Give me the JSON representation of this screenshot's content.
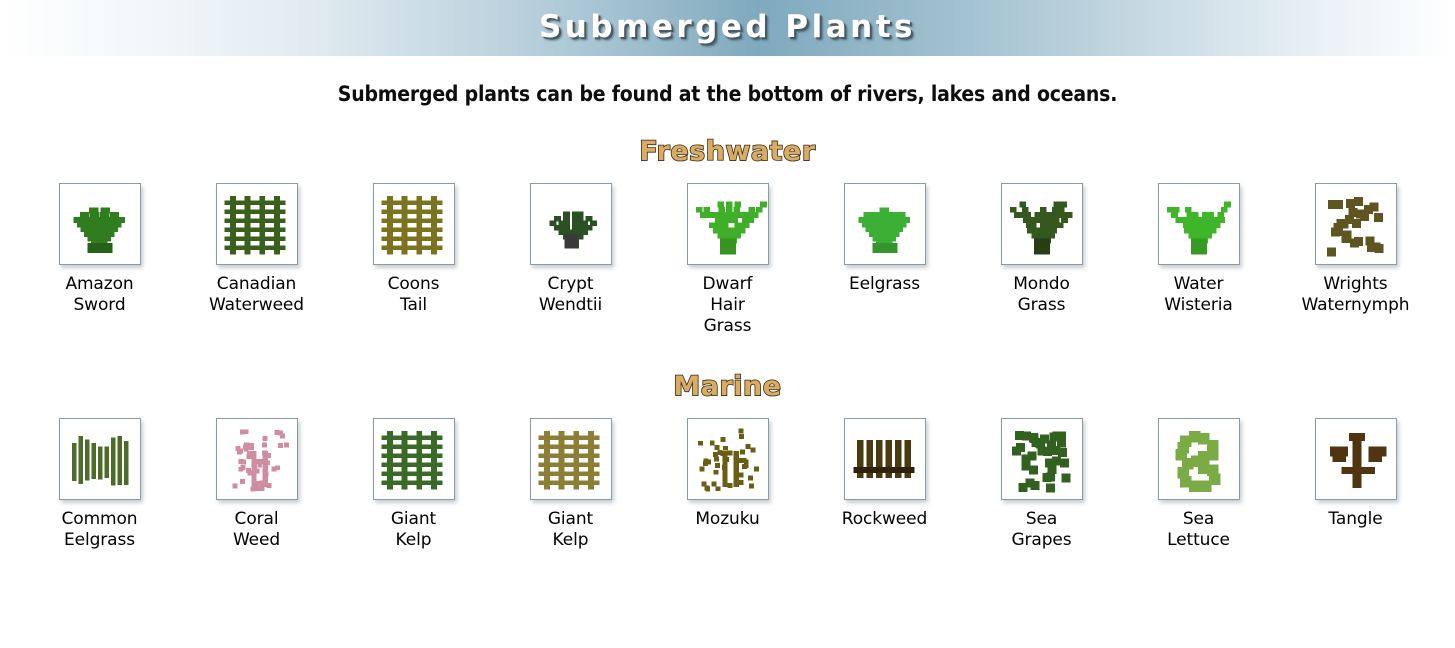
{
  "header": {
    "title": "Submerged Plants",
    "gradient_center_color": "#7fa9bd",
    "title_color": "#ffffff"
  },
  "subtitle": "Submerged plants can be found at the bottom of rivers, lakes and oceans.",
  "section_heading_color": "#d9ab63",
  "section_heading_outline_color": "#3a2a12",
  "sections": [
    {
      "heading": "Freshwater",
      "items": [
        {
          "label": "Amazon\nSword",
          "icon": "amazon-sword-icon",
          "color": "#2f7d1e"
        },
        {
          "label": "Canadian\nWaterweed",
          "icon": "canadian-waterweed-icon",
          "color": "#39601c"
        },
        {
          "label": "Coons\nTail",
          "icon": "coons-tail-icon",
          "color": "#7b7320"
        },
        {
          "label": "Crypt\nWendtii",
          "icon": "crypt-wendtii-icon",
          "color": "#2c5026"
        },
        {
          "label": "Dwarf\nHair\nGrass",
          "icon": "dwarf-hair-grass-icon",
          "color": "#3fae28"
        },
        {
          "label": "Eelgrass",
          "icon": "eelgrass-icon",
          "color": "#3cb034"
        },
        {
          "label": "Mondo\nGrass",
          "icon": "mondo-grass-icon",
          "color": "#35581f"
        },
        {
          "label": "Water\nWisteria",
          "icon": "water-wisteria-icon",
          "color": "#3fb52a"
        },
        {
          "label": "Wrights\nWaternymph",
          "icon": "wrights-waternymph-icon",
          "color": "#5e5521"
        }
      ]
    },
    {
      "heading": "Marine",
      "items": [
        {
          "label": "Common\nEelgrass",
          "icon": "common-eelgrass-icon",
          "color": "#4d6b29"
        },
        {
          "label": "Coral\nWeed",
          "icon": "coral-weed-icon",
          "color": "#d08da0"
        },
        {
          "label": "Giant\nKelp",
          "icon": "giant-kelp-green-icon",
          "color": "#3a6b26"
        },
        {
          "label": "Giant\nKelp",
          "icon": "giant-kelp-olive-icon",
          "color": "#8a7f34"
        },
        {
          "label": "Mozuku",
          "icon": "mozuku-icon",
          "color": "#6b5c16"
        },
        {
          "label": "Rockweed",
          "icon": "rockweed-icon",
          "color": "#4a3a10"
        },
        {
          "label": "Sea\nGrapes",
          "icon": "sea-grapes-icon",
          "color": "#32611f"
        },
        {
          "label": "Sea\nLettuce",
          "icon": "sea-lettuce-icon",
          "color": "#7aab45"
        },
        {
          "label": "Tangle",
          "icon": "tangle-icon",
          "color": "#4f3510"
        }
      ]
    }
  ]
}
